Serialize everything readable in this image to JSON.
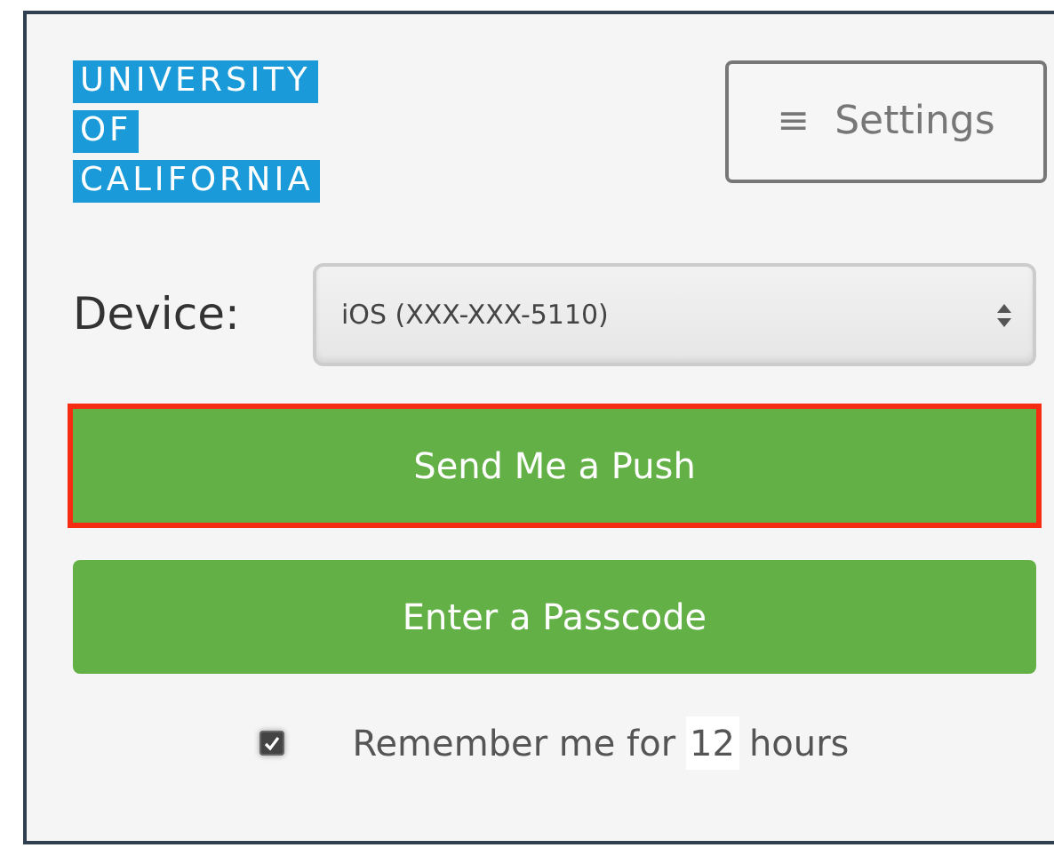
{
  "logo": {
    "lines": [
      "UNIVERSITY",
      "OF",
      "CALIFORNIA"
    ]
  },
  "settings_button": {
    "icon": "≡",
    "label": "Settings"
  },
  "device": {
    "label": "Device:",
    "value": "iOS (XXX-XXX-5110)"
  },
  "actions": [
    {
      "label": "Send Me a Push",
      "highlighted": true
    },
    {
      "label": "Enter a Passcode",
      "highlighted": false
    }
  ],
  "remember": {
    "checked": true,
    "before": "Remember me for",
    "hours_value": "12",
    "after": "hours"
  }
}
